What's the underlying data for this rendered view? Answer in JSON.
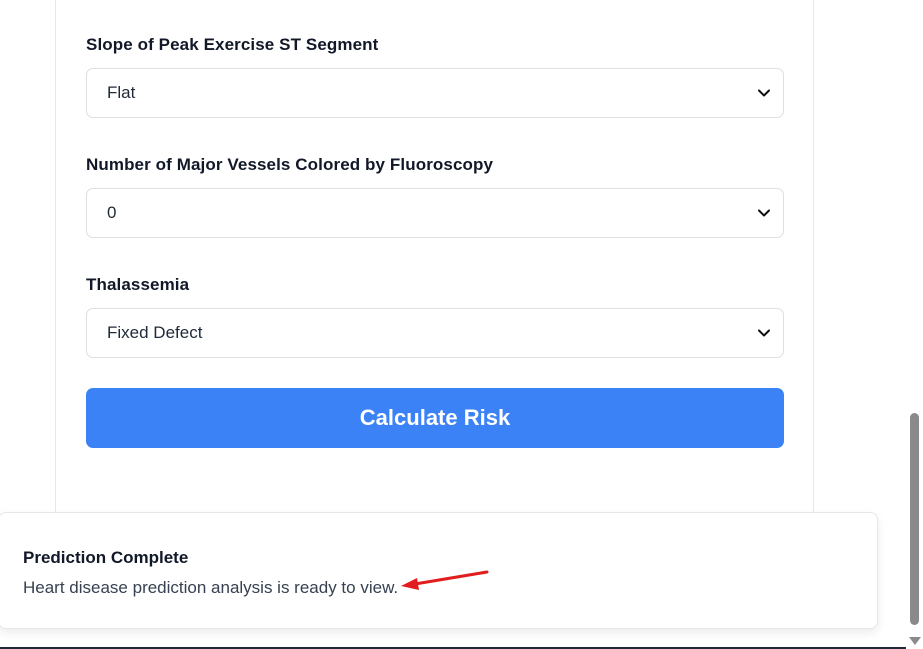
{
  "form": {
    "slope": {
      "label": "Slope of Peak Exercise ST Segment",
      "value": "Flat"
    },
    "vessels": {
      "label": "Number of Major Vessels Colored by Fluoroscopy",
      "value": "0"
    },
    "thalassemia": {
      "label": "Thalassemia",
      "value": "Fixed Defect"
    },
    "submit_label": "Calculate Risk"
  },
  "toast": {
    "title": "Prediction Complete",
    "description": "Heart disease prediction analysis is ready to view."
  },
  "colors": {
    "primary_button": "#3b82f6",
    "annotation_arrow": "#e11d1d"
  },
  "icons": {
    "select_chevron": "chevron-down-icon",
    "annotation": "red-arrow-icon"
  }
}
